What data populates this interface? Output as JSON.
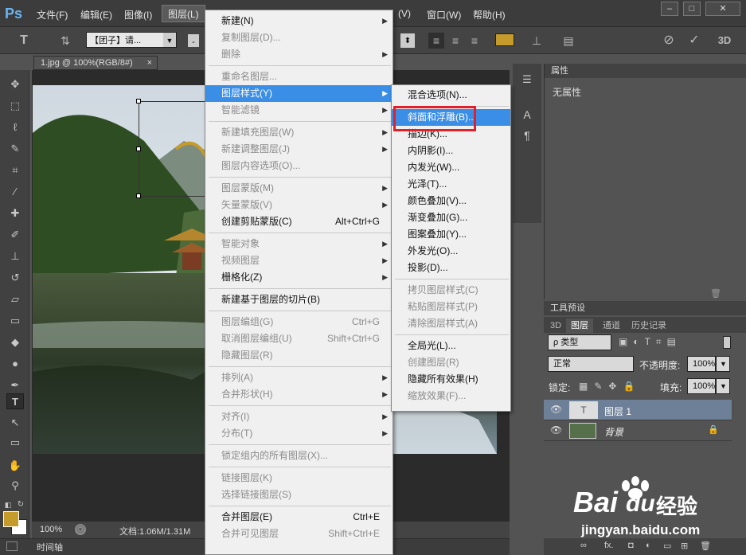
{
  "app": {
    "logo": "Ps",
    "menus": [
      "文件(F)",
      "编辑(E)",
      "图像(I)",
      "图层(L)",
      "(V)",
      "窗口(W)",
      "帮助(H)"
    ],
    "active_menu": "图层(L)",
    "window_buttons": [
      "–",
      "□",
      "✕"
    ]
  },
  "options": {
    "font_name": "【团子】请...",
    "aa_label": "a",
    "commit_icon": "✓",
    "cancel_icon": "⊘",
    "threed_label": "3D"
  },
  "document": {
    "tab_title": "1.jpg @ 100%(RGB/8#)",
    "tab_close": "×",
    "zoom": "100%",
    "doc_info": "文档:1.06M/1.31M",
    "timeline": "时间轴"
  },
  "colors": {
    "foreground": "#c59b2c",
    "background": "#ffffff",
    "highlight": "#3a8ee6",
    "marker": "#e0202a"
  },
  "layer_menu": {
    "items": [
      {
        "label": "新建(N)",
        "sub": true
      },
      {
        "label": "复制图层(D)...",
        "dis": true
      },
      {
        "label": "删除",
        "dis": true,
        "sub": true
      },
      {
        "sep": true
      },
      {
        "label": "重命名图层...",
        "dis": true
      },
      {
        "label": "图层样式(Y)",
        "sub": true,
        "hl": true
      },
      {
        "label": "智能滤镜",
        "dis": true,
        "sub": true
      },
      {
        "sep": true
      },
      {
        "label": "新建填充图层(W)",
        "dis": true,
        "sub": true
      },
      {
        "label": "新建调整图层(J)",
        "dis": true,
        "sub": true
      },
      {
        "label": "图层内容选项(O)...",
        "dis": true
      },
      {
        "sep": true
      },
      {
        "label": "图层蒙版(M)",
        "dis": true,
        "sub": true
      },
      {
        "label": "矢量蒙版(V)",
        "dis": true,
        "sub": true
      },
      {
        "label": "创建剪贴蒙版(C)",
        "sc": "Alt+Ctrl+G"
      },
      {
        "sep": true
      },
      {
        "label": "智能对象",
        "dis": true,
        "sub": true
      },
      {
        "label": "视频图层",
        "dis": true,
        "sub": true
      },
      {
        "label": "栅格化(Z)",
        "sub": true
      },
      {
        "sep": true
      },
      {
        "label": "新建基于图层的切片(B)"
      },
      {
        "sep": true
      },
      {
        "label": "图层编组(G)",
        "dis": true,
        "sc": "Ctrl+G"
      },
      {
        "label": "取消图层编组(U)",
        "dis": true,
        "sc": "Shift+Ctrl+G"
      },
      {
        "label": "隐藏图层(R)",
        "dis": true
      },
      {
        "sep": true
      },
      {
        "label": "排列(A)",
        "dis": true,
        "sub": true
      },
      {
        "label": "合并形状(H)",
        "dis": true,
        "sub": true
      },
      {
        "sep": true
      },
      {
        "label": "对齐(I)",
        "dis": true,
        "sub": true
      },
      {
        "label": "分布(T)",
        "dis": true,
        "sub": true
      },
      {
        "sep": true
      },
      {
        "label": "锁定组内的所有图层(X)...",
        "dis": true
      },
      {
        "sep": true
      },
      {
        "label": "链接图层(K)",
        "dis": true
      },
      {
        "label": "选择链接图层(S)",
        "dis": true
      },
      {
        "sep": true
      },
      {
        "label": "合并图层(E)",
        "sc": "Ctrl+E"
      },
      {
        "label": "合并可见图层",
        "dis": true,
        "sc": "Shift+Ctrl+E"
      }
    ]
  },
  "style_menu": {
    "items": [
      {
        "label": "混合选项(N)..."
      },
      {
        "sep": true
      },
      {
        "label": "斜面和浮雕(B)...",
        "hl": true
      },
      {
        "label": "描边(K)..."
      },
      {
        "label": "内阴影(I)..."
      },
      {
        "label": "内发光(W)..."
      },
      {
        "label": "光泽(T)..."
      },
      {
        "label": "颜色叠加(V)..."
      },
      {
        "label": "渐变叠加(G)..."
      },
      {
        "label": "图案叠加(Y)..."
      },
      {
        "label": "外发光(O)..."
      },
      {
        "label": "投影(D)..."
      },
      {
        "sep": true
      },
      {
        "label": "拷贝图层样式(C)",
        "dis": true
      },
      {
        "label": "粘贴图层样式(P)",
        "dis": true
      },
      {
        "label": "清除图层样式(A)",
        "dis": true
      },
      {
        "sep": true
      },
      {
        "label": "全局光(L)..."
      },
      {
        "label": "创建图层(R)",
        "dis": true
      },
      {
        "label": "隐藏所有效果(H)"
      },
      {
        "label": "缩放效果(F)...",
        "dis": true
      }
    ]
  },
  "properties": {
    "title": "属性",
    "body": "无属性"
  },
  "presets": {
    "title": "工具预设"
  },
  "layers": {
    "tabs": [
      "3D",
      "图层",
      "通道",
      "历史记录"
    ],
    "filter": "ρ 类型",
    "blend": "正常",
    "opacity_label": "不透明度:",
    "opacity": "100%",
    "lock_label": "锁定:",
    "fill_label": "填充:",
    "fill": "100%",
    "rows": [
      {
        "name": "图层 1",
        "selected": true,
        "thumb_glyph": "T"
      },
      {
        "name": "背景",
        "italic": true,
        "locked": true
      }
    ],
    "footer_fx": "fx."
  },
  "watermark": {
    "brand": "Bai",
    "brand2": "du",
    "cn": "经验",
    "url": "jingyan.baidu.com"
  }
}
